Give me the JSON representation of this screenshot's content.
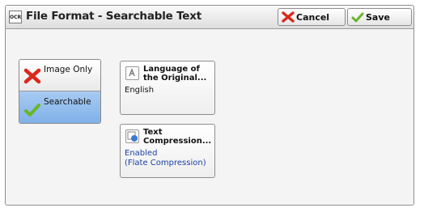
{
  "header": {
    "icon_text": "OCR",
    "title": "File Format - Searchable Text",
    "cancel_label": "Cancel",
    "save_label": "Save"
  },
  "mode": {
    "options": [
      {
        "label": "Image Only",
        "selected": false,
        "icon": "red-x-icon"
      },
      {
        "label": "Searchable",
        "selected": true,
        "icon": "green-check-icon"
      }
    ]
  },
  "language": {
    "title_line1": "Language of",
    "title_line2": "the Original...",
    "value": "English"
  },
  "compression": {
    "title_line1": "Text",
    "title_line2": "Compression...",
    "value_line1": "Enabled",
    "value_line2": "(Flate Compression)"
  },
  "colors": {
    "selected_bg": "#8fbaec",
    "value_blue": "#1a3fa3",
    "cancel_red": "#d9281c",
    "check_green": "#69b52a"
  }
}
